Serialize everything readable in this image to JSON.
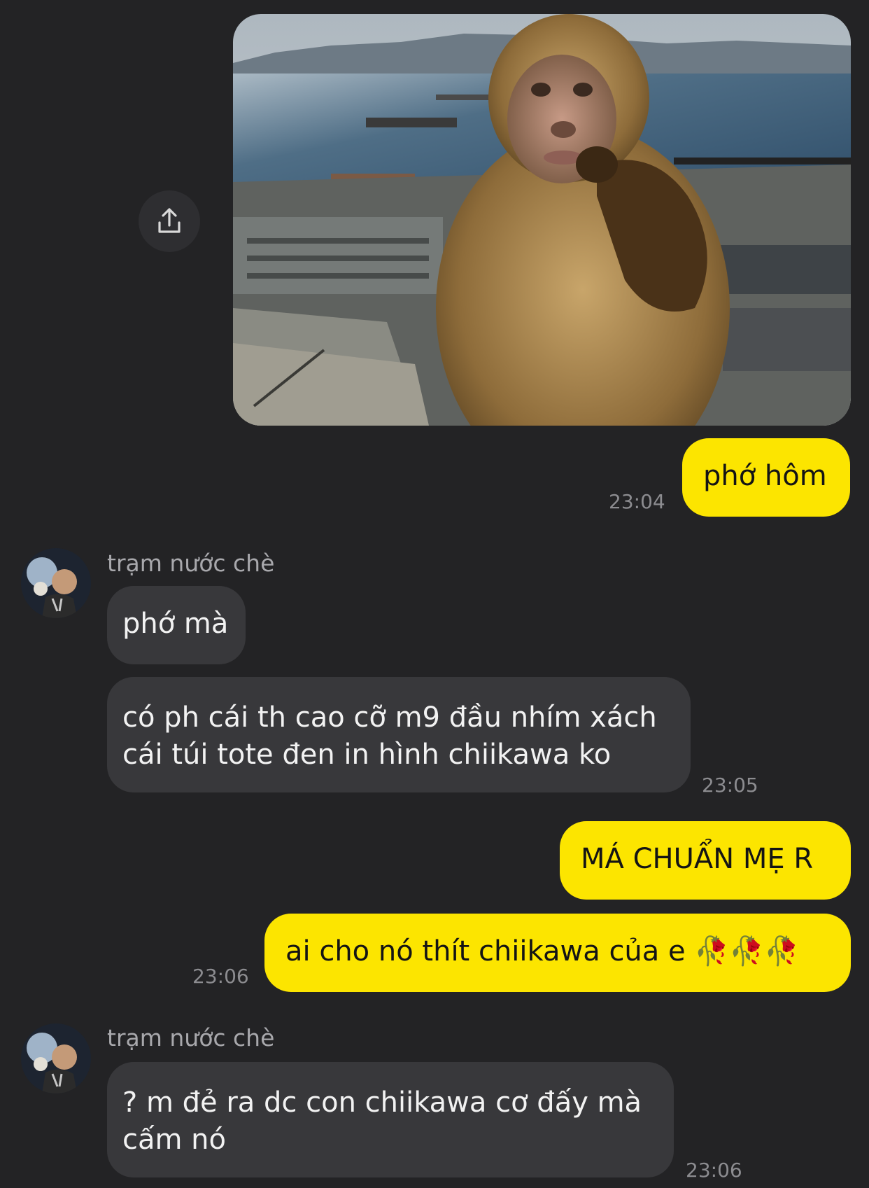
{
  "messages": {
    "m1_text": "phớ hôm",
    "m1_time": "23:04",
    "sender_name_1": "trạm nước chè",
    "r1_text": "phớ mà",
    "r2_text": "có ph cái th cao cỡ m9 đầu nhím xách cái túi tote đen in hình chiikawa ko",
    "r2_time": "23:05",
    "m2_text": "MÁ CHUẨN MẸ R",
    "m3_text": "ai cho nó thít chiikawa của e",
    "m3_emoji": "🥀🥀🥀",
    "m3_time": "23:06",
    "sender_name_2": "trạm nước chè",
    "r3_text": "? m đẻ ra dc con chiikawa cơ đấy mà cấm nó",
    "r3_time": "23:06"
  },
  "icons": {
    "share": "share-icon",
    "photo": "monkey-photo",
    "avatar": "avatar-image"
  },
  "colors": {
    "background": "#232325",
    "my_bubble": "#fce500",
    "their_bubble": "#38383b",
    "timestamp": "#8c8c90"
  }
}
